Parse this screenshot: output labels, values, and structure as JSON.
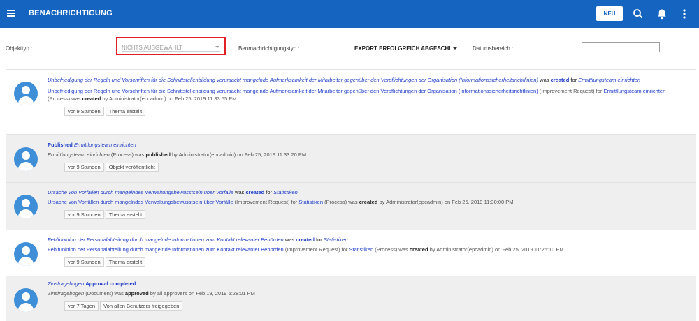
{
  "header": {
    "title": "BENACHRICHTIGUNG",
    "new_button": "NEU",
    "icons": [
      "menu-icon",
      "search-icon",
      "bell-icon",
      "more-vert-icon"
    ],
    "color": "#1565c0"
  },
  "filters": {
    "object_type_label": "Objekttyp :",
    "object_type_value": "NICHTS AUSGEWÄHLT",
    "notification_type_label": "Benmachrichtigungstyp :",
    "notification_type_value": "EXPORT ERFOLGREICH ABGESCHl",
    "date_range_label": "Datumsbereich :",
    "date_range_value": ""
  },
  "notifications": [
    {
      "headline": {
        "subject": "Unbefriedigung der Regeln und Vorschriften für die Schnittstellenbildung verursacht mangelnde Aufmerksamkeit der Mitarbeiter gegenüber den Verpflichtungen der Organisation (Informationssicherheitsrichtlinien)",
        "was": "was",
        "action": "created",
        "for": "for",
        "target": "Ermittlungsteam einrichten"
      },
      "detail": {
        "subject": "Unbefriedigung der Regeln und Vorschriften für die Schnittstellenbildung verursacht mangelnde Aufmerksamkeit der Mitarbeiter gegenüber den Verpflichtungen der Organisation (Informationssicherheitsrichtlinien)",
        "subject_type": "(Improvement Request) for",
        "target": "Ermittlungsteam einrichten",
        "target_type": "(Process) was",
        "action": "created",
        "tail": "by Administrator(epcadmin) on Feb 25, 2019 11:33:55 PM"
      },
      "time": "vor 9 Stunden",
      "tag": "Thema erstellt"
    },
    {
      "headline": {
        "action": "Published",
        "target": "Ermittlungsteam einrichten"
      },
      "detail": {
        "subject": "Ermittlungsteam einrichten",
        "subject_type": "(Process) was",
        "action": "published",
        "tail": "by Administrator(epcadmin) on Feb 25, 2019 11:33:20 PM"
      },
      "time": "vor 9 Stunden",
      "tag": "Objekt veröffentlicht"
    },
    {
      "headline": {
        "subject": "Ursache von Vorfällen durch mangelndes Verwaltungsbewusstsein über Vorfälle",
        "was": "was",
        "action": "created",
        "for": "for",
        "target": "Statistiken"
      },
      "detail": {
        "subject": "Ursache von Vorfällen durch mangelndes Verwaltungsbewusstsein über Vorfälle",
        "subject_type": "(Improvement Request) for",
        "target": "Statistiken",
        "target_type": "(Process) was",
        "action": "created",
        "tail": "by Administrator(epcadmin) on Feb 25, 2019 11:30:00 PM"
      },
      "time": "vor 9 Stunden",
      "tag": "Thema erstellt"
    },
    {
      "headline": {
        "subject": "Fehlfunktion der Personalabteilung durch mangelnde Informationen zum Kontakt relevanter Behörden",
        "was": "was",
        "action": "created",
        "for": "for",
        "target": "Statistiken"
      },
      "detail": {
        "subject": "Fehlfunktion der Personalabteilung durch mangelnde Informationen zum Kontakt relevanter Behörden",
        "subject_type": "(Improvement Request) for",
        "target": "Statistiken",
        "target_type": "(Process) was",
        "action": "created",
        "tail": "by Administrator(epcadmin) on Feb 25, 2019 11:25:10 PM"
      },
      "time": "vor 9 Stunden",
      "tag": "Thema erstellt"
    },
    {
      "headline": {
        "subject": "Zinsfragebogen",
        "action": "Approval completed"
      },
      "detail": {
        "subject": "Zinsfragebogen",
        "subject_type": "(Document) was",
        "action": "approved",
        "tail": "by all approvers on Feb 19, 2019 6:28:01 PM"
      },
      "time": "vor 7 Tagen",
      "tag": "Von allen Benutzers freigegeben"
    }
  ]
}
